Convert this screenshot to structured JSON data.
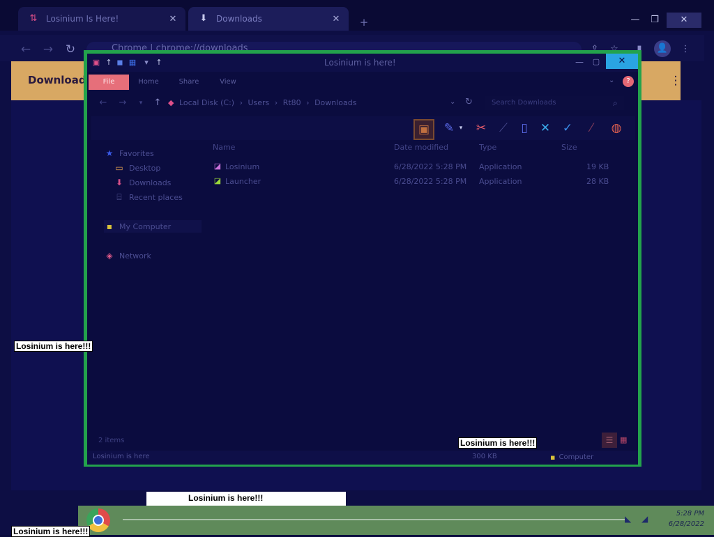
{
  "browser": {
    "tabs": [
      {
        "label": "Losinium Is Here!",
        "icon": "gmail-icon"
      },
      {
        "label": "Downloads",
        "icon": "download-icon"
      }
    ],
    "new_tab_icon": "+",
    "url_prefix": "Chrome",
    "url_separator": "|",
    "url": "chrome://downloads",
    "page_title": "Downloads"
  },
  "explorer": {
    "title": "Losinium is here!",
    "ribbon_tabs": [
      "File",
      "Home",
      "Share",
      "View"
    ],
    "breadcrumb": [
      "Local Disk (C:)",
      "Users",
      "Rt80",
      "Downloads"
    ],
    "search_placeholder": "Search Downloads",
    "nav": {
      "favorites": "Favorites",
      "desktop": "Desktop",
      "downloads": "Downloads",
      "recent": "Recent places",
      "computer": "My Computer",
      "network": "Network"
    },
    "columns": {
      "name": "Name",
      "date": "Date modified",
      "type": "Type",
      "size": "Size"
    },
    "files": [
      {
        "name": "Losinium",
        "date": "6/28/2022 5:28 PM",
        "type": "Application",
        "size": "19 KB"
      },
      {
        "name": "Launcher",
        "date": "6/28/2022 5:28 PM",
        "type": "Application",
        "size": "28 KB"
      }
    ],
    "item_count": "2 items",
    "status_left": "Losinium is here",
    "status_size": "300 KB",
    "status_computer": "Computer"
  },
  "overlays": {
    "message": "Losinium is here!!!"
  },
  "taskbar": {
    "time": "5:28 PM",
    "date": "6/28/2022"
  },
  "colors": {
    "window_border": "#23a24c",
    "downloads_bar": "#d8a863",
    "file_tab": "#e66f7a",
    "close_button": "#2aa4e2",
    "taskbar": "#5f8a5a"
  }
}
